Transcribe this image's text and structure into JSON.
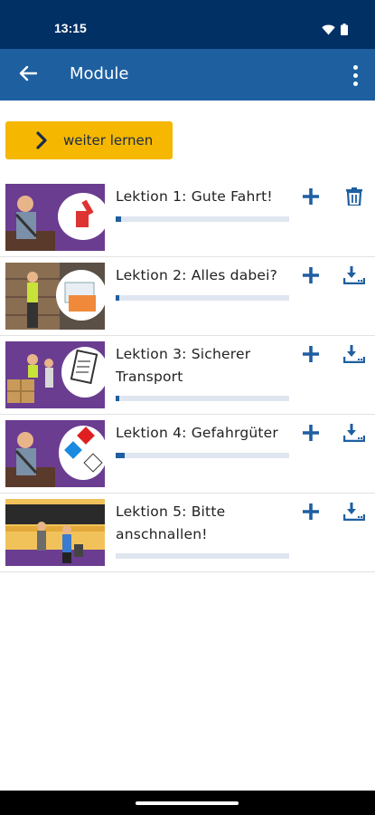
{
  "status_bar": {
    "time": "13:15"
  },
  "app_bar": {
    "title": "Module"
  },
  "continue_button": {
    "label": "weiter lernen"
  },
  "colors": {
    "primary": "#1e5fa0",
    "accent": "#f5b700",
    "status_bar": "#003064"
  },
  "lessons": [
    {
      "title": "Lektion 1: Gute Fahrt!",
      "progress": 0.03,
      "action": "delete-icon"
    },
    {
      "title": "Lektion 2: Alles dabei?",
      "progress": 0.02,
      "action": "download-icon"
    },
    {
      "title": "Lektion 3: Sicherer Transport",
      "progress": 0.02,
      "action": "download-icon"
    },
    {
      "title": "Lektion 4: Gefahrgüter",
      "progress": 0.05,
      "action": "download-icon"
    },
    {
      "title": "Lektion 5: Bitte anschnallen!",
      "progress": 0.0,
      "action": "download-icon"
    }
  ]
}
